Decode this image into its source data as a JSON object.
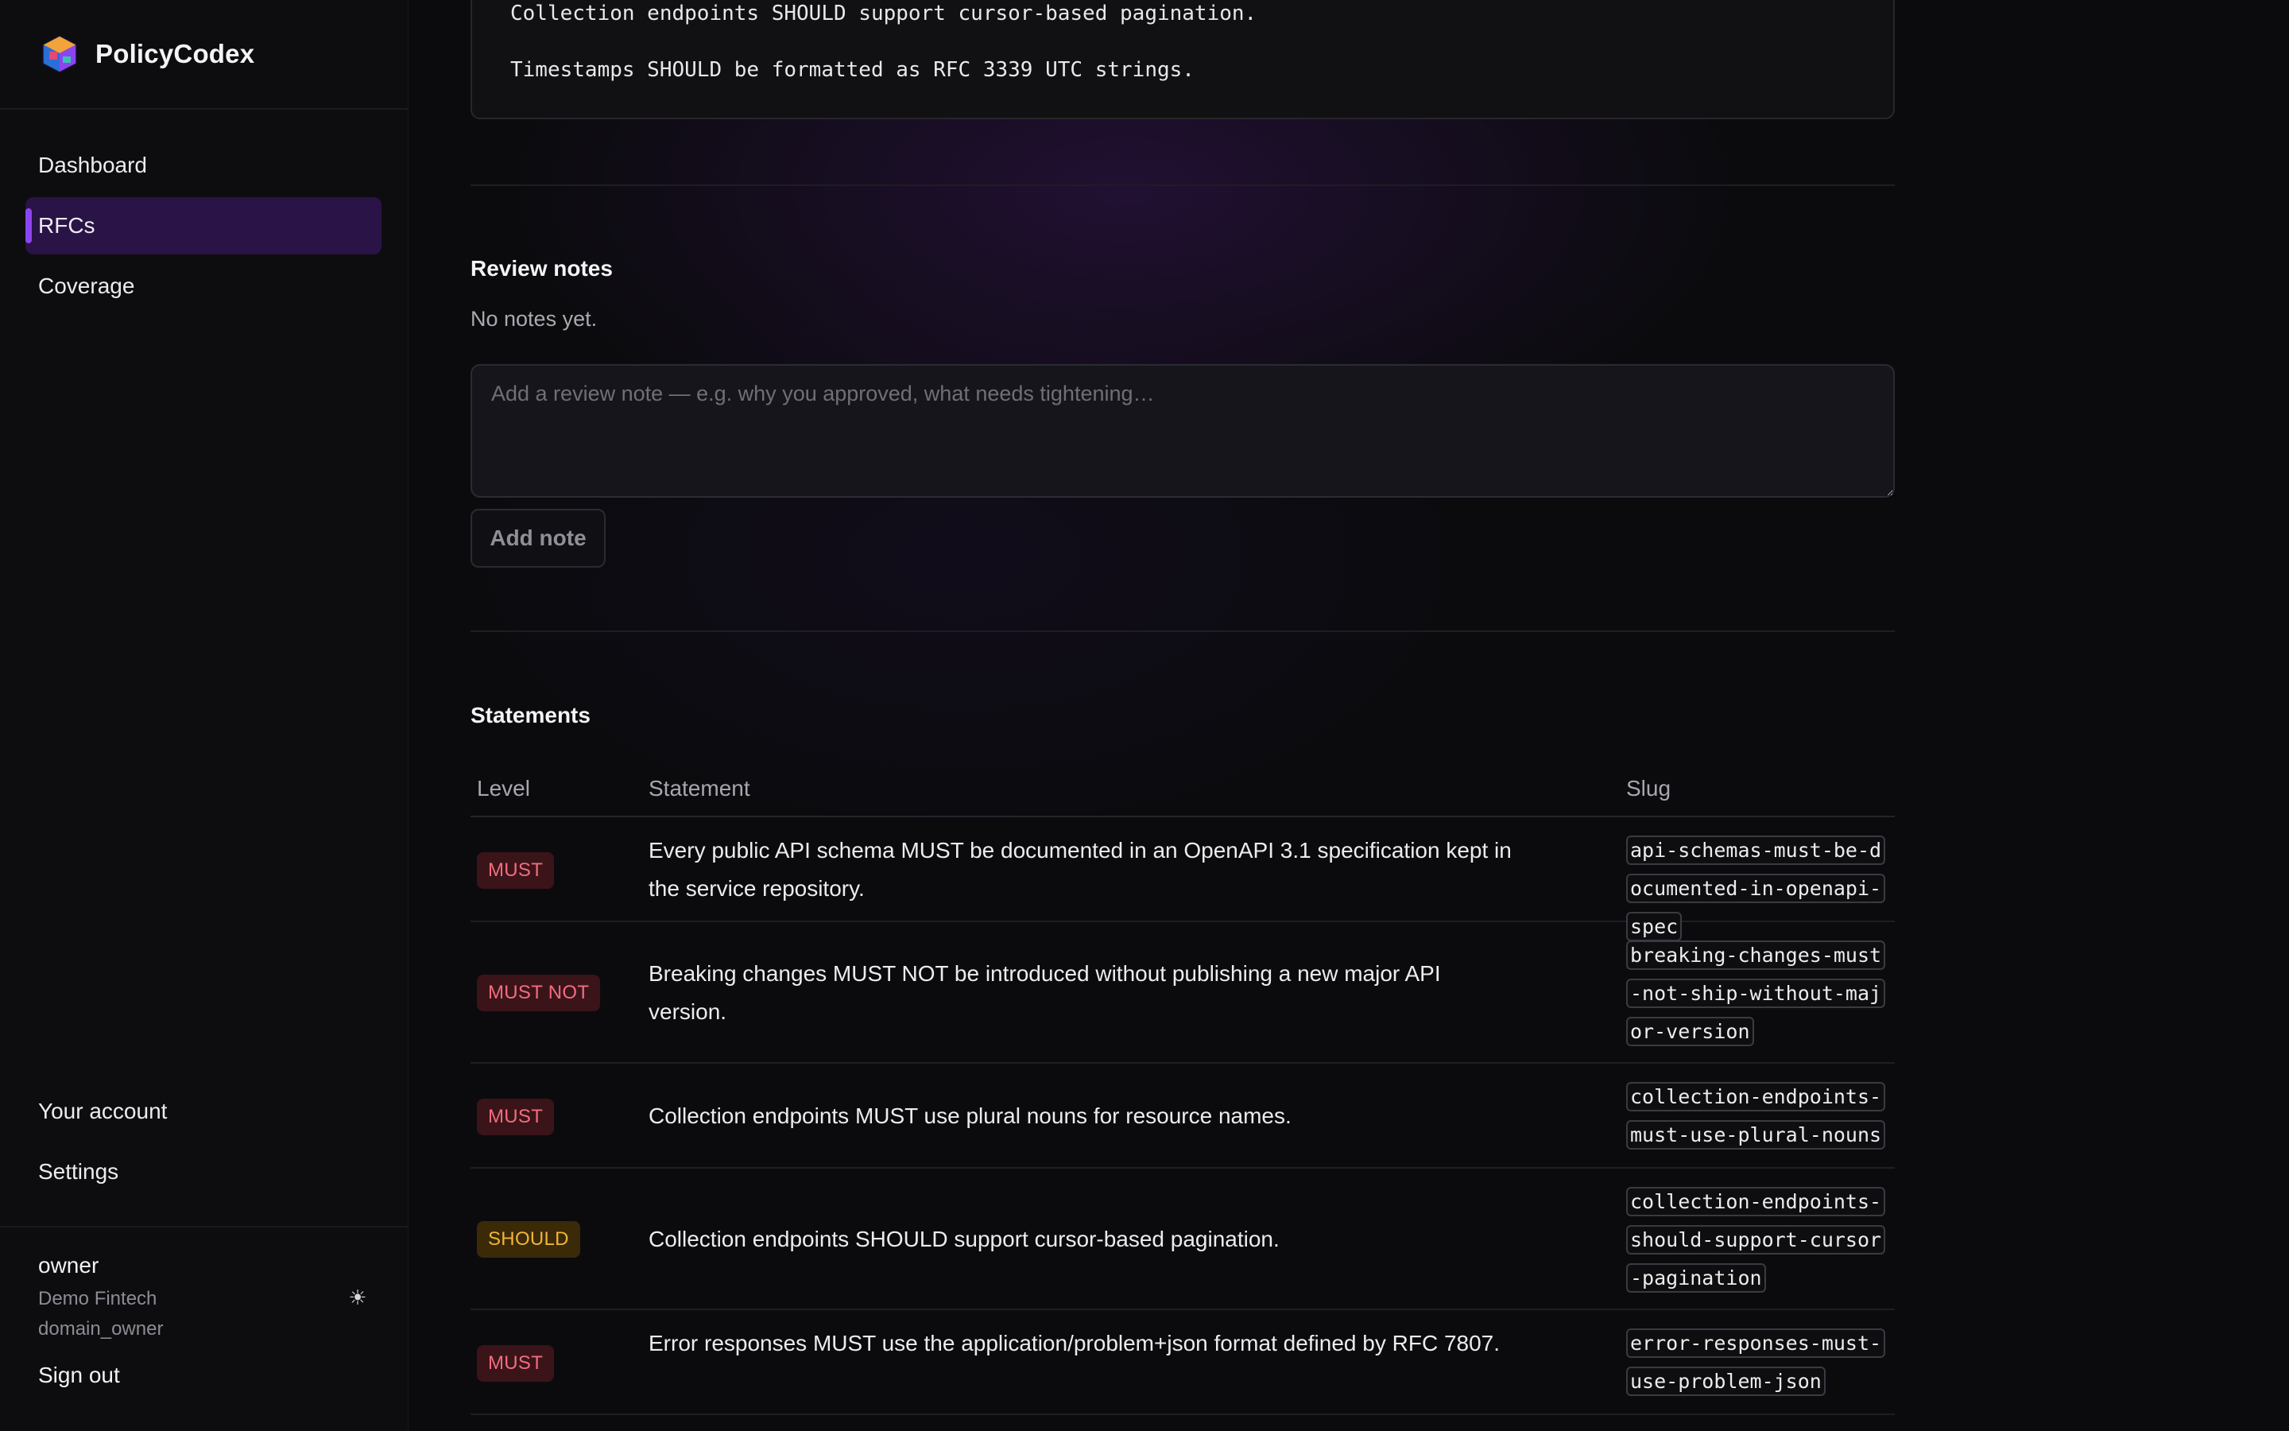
{
  "app": {
    "name": "PolicyCodex"
  },
  "sidebar": {
    "nav": [
      {
        "label": "Dashboard"
      },
      {
        "label": "RFCs"
      },
      {
        "label": "Coverage"
      }
    ],
    "bottom_nav": [
      {
        "label": "Your account"
      },
      {
        "label": "Settings"
      }
    ],
    "user": {
      "name": "owner",
      "org": "Demo Fintech",
      "role": "domain_owner"
    },
    "theme_icon": "sun-icon",
    "sign_out": "Sign out"
  },
  "rfc_body": {
    "lines": [
      "Collection endpoints SHOULD support cursor-based pagination.",
      "Timestamps SHOULD be formatted as RFC 3339 UTC strings."
    ]
  },
  "review_notes": {
    "title": "Review notes",
    "empty_text": "No notes yet.",
    "placeholder": "Add a review note — e.g. why you approved, what needs tightening…",
    "add_button": "Add note"
  },
  "statements": {
    "title": "Statements",
    "columns": {
      "level": "Level",
      "statement": "Statement",
      "slug": "Slug"
    },
    "rows": [
      {
        "level": "MUST",
        "statement": "Every public API schema MUST be documented in an OpenAPI 3.1 specification kept in the service repository.",
        "slug": "api-schemas-must-be-documented-in-openapi-spec"
      },
      {
        "level": "MUST NOT",
        "statement": "Breaking changes MUST NOT be introduced without publishing a new major API version.",
        "slug": "breaking-changes-must-not-ship-without-major-version"
      },
      {
        "level": "MUST",
        "statement": "Collection endpoints MUST use plural nouns for resource names.",
        "slug": "collection-endpoints-must-use-plural-nouns"
      },
      {
        "level": "SHOULD",
        "statement": "Collection endpoints SHOULD support cursor-based pagination.",
        "slug": "collection-endpoints-should-support-cursor-pagination"
      },
      {
        "level": "MUST",
        "statement": "Error responses MUST use the application/problem+json format defined by RFC 7807.",
        "slug": "error-responses-must-use-problem-json"
      }
    ]
  },
  "colors": {
    "accent": "#8b45f0",
    "active_nav_bg": "#2a1346",
    "must": "#f26d7d",
    "should": "#f2b43a"
  }
}
